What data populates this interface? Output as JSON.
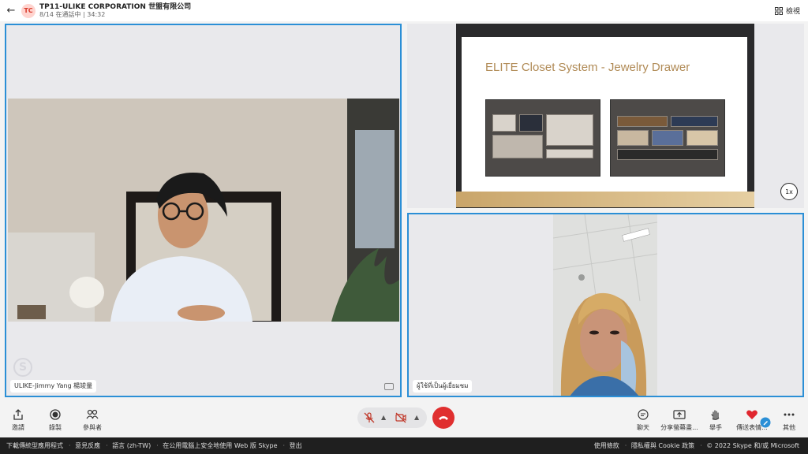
{
  "header": {
    "avatar_initials": "TC",
    "title": "TP11-ULIKE CORPORATION 世盟有限公司",
    "subtitle": "8/14 在通話中 | 34:32",
    "grid_label": "檢視"
  },
  "tiles": {
    "left_name": "ULIKE-Jimmy Yang 楊竣量",
    "bottom_right_name": "ผู้ใช้ที่เป็นผู้เยี่ยมชม"
  },
  "slide": {
    "title": "ELITE Closet System - Jewelry Drawer",
    "speed": "1x"
  },
  "controls": {
    "left": [
      {
        "label": "邀請",
        "icon": "share-icon"
      },
      {
        "label": "錄製",
        "icon": "record-icon"
      },
      {
        "label": "參與者",
        "icon": "participants-icon"
      }
    ],
    "right": [
      {
        "label": "聊天",
        "icon": "chat-icon"
      },
      {
        "label": "分享螢幕畫...",
        "icon": "share-screen-icon"
      },
      {
        "label": "舉手",
        "icon": "raise-hand-icon"
      },
      {
        "label": "傳送表情...",
        "icon": "heart-icon"
      },
      {
        "label": "其他",
        "icon": "more-icon"
      }
    ]
  },
  "footer": {
    "left": [
      "下載傳統型應用程式",
      "意見反應",
      "語言 (zh-TW)",
      "在公用電腦上安全地使用 Web 版 Skype",
      "登出"
    ],
    "right": [
      "使用條款",
      "隱私權與 Cookie 政策",
      "© 2022 Skype 和/或 Microsoft"
    ]
  },
  "colors": {
    "accent": "#2b8fd6",
    "end_call": "#e02f2f",
    "heart": "#e0262e"
  }
}
